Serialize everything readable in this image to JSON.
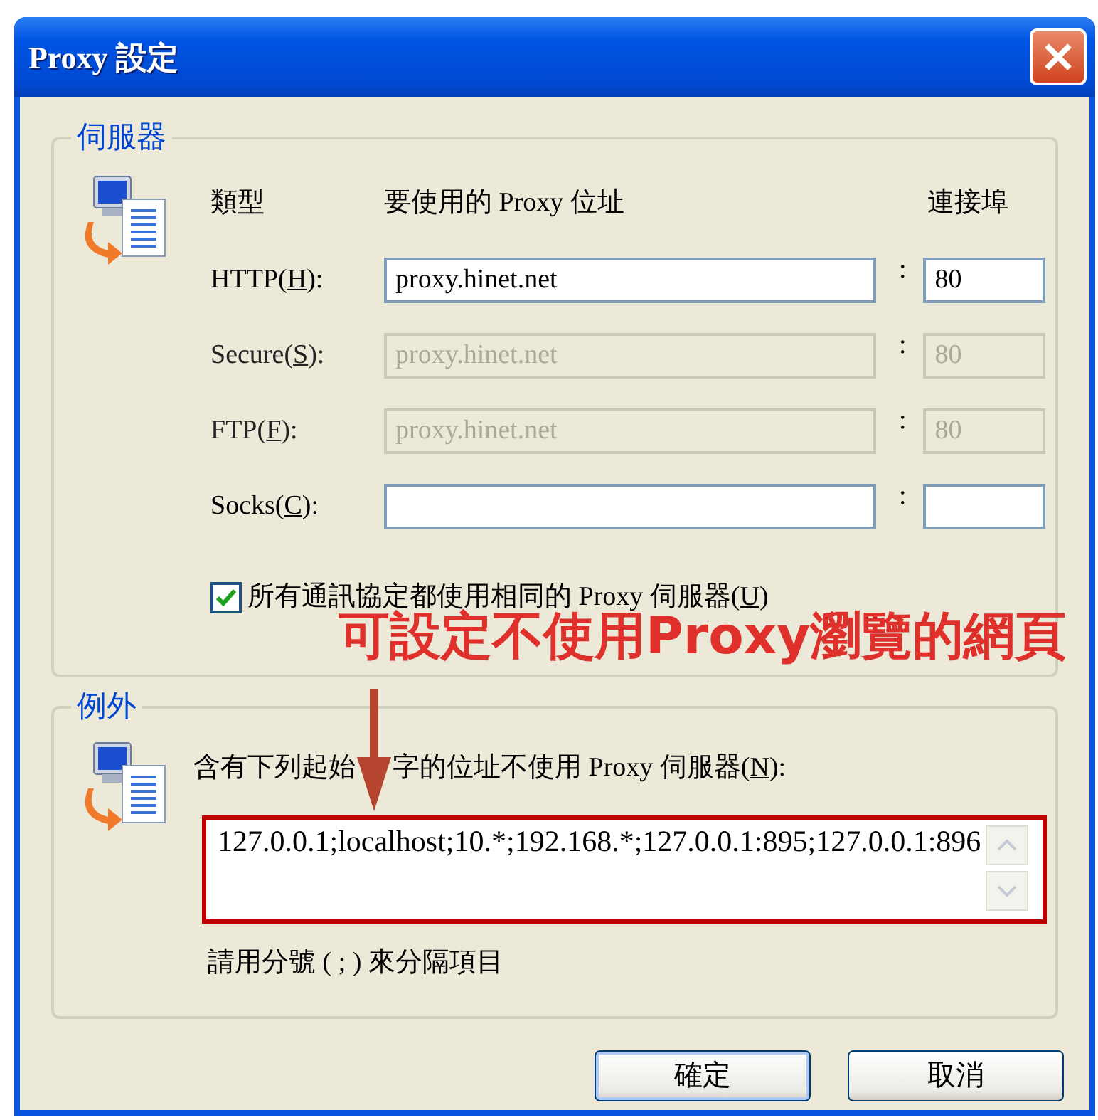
{
  "window": {
    "title": "Proxy 設定"
  },
  "servers": {
    "legend": "伺服器",
    "headers": {
      "type": "類型",
      "address": "要使用的 Proxy 位址",
      "port": "連接埠"
    },
    "rows": [
      {
        "label": "HTTP(",
        "key": "H",
        "after": "):",
        "address": "proxy.hinet.net",
        "separator": ":",
        "port": "80",
        "disabled": false
      },
      {
        "label": "Secure(",
        "key": "S",
        "after": "):",
        "address": "proxy.hinet.net",
        "separator": ":",
        "port": "80",
        "disabled": true
      },
      {
        "label": "FTP(",
        "key": "F",
        "after": "):",
        "address": "proxy.hinet.net",
        "separator": ":",
        "port": "80",
        "disabled": true
      },
      {
        "label": "Socks(",
        "key": "C",
        "after": "):",
        "address": "",
        "separator": ":",
        "port": "",
        "disabled": false
      }
    ],
    "same_for_all": {
      "label": "所有通訊協定都使用相同的 Proxy 伺服器(",
      "key": "U",
      "after": ")",
      "checked": true
    }
  },
  "annotation": {
    "text": "可設定不使用Proxy瀏覽的網頁"
  },
  "exceptions": {
    "legend": "例外",
    "label_start": "含有下列起始",
    "label": "字的位址不使用 Proxy 伺服器(",
    "key": "N",
    "after": "):",
    "value": "127.0.0.1;localhost;10.*;192.168.*;127.0.0.1:895;127.0.0.1:896",
    "hint": "請用分號 ( ; ) 來分隔項目"
  },
  "buttons": [
    {
      "label": "確定",
      "default": true
    },
    {
      "label": "取消",
      "default": false
    }
  ]
}
